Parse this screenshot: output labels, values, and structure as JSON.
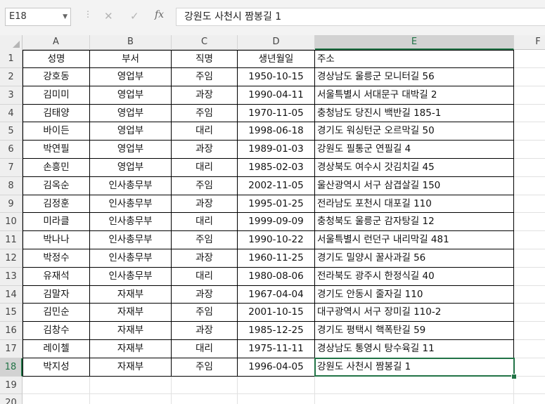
{
  "formula_bar": {
    "name_box": "E18",
    "cancel_icon": "✕",
    "enter_icon": "✓",
    "fx_label": "fx",
    "formula": "강원도 사천시 짬봉길 1"
  },
  "columns": [
    "A",
    "B",
    "C",
    "D",
    "E",
    "F"
  ],
  "active_column": "E",
  "active_row": 18,
  "row_numbers": [
    "1",
    "2",
    "3",
    "4",
    "5",
    "6",
    "7",
    "8",
    "9",
    "10",
    "11",
    "12",
    "13",
    "14",
    "15",
    "16",
    "17",
    "18",
    "19",
    "20"
  ],
  "table": {
    "headers": [
      "성명",
      "부서",
      "직명",
      "생년월일",
      "주소"
    ],
    "rows": [
      [
        "강호동",
        "영업부",
        "주임",
        "1950-10-15",
        "경상남도 울릉군 모니터길 56"
      ],
      [
        "김미미",
        "영업부",
        "과장",
        "1990-04-11",
        "서울특별시 서대문구 대박길 2"
      ],
      [
        "김태양",
        "영업부",
        "주임",
        "1970-11-05",
        "충청남도 당진시 백반길 185-1"
      ],
      [
        "바이든",
        "영업부",
        "대리",
        "1998-06-18",
        "경기도 워싱턴군 오르막길 50"
      ],
      [
        "박연필",
        "영업부",
        "과장",
        "1989-01-03",
        "강원도 필통군 연필길 4"
      ],
      [
        "손흥민",
        "영업부",
        "대리",
        "1985-02-03",
        "경상북도 여수시 갓김치길 45"
      ],
      [
        "김옥순",
        "인사총무부",
        "주임",
        "2002-11-05",
        "울산광역시 서구 삼겹살길 150"
      ],
      [
        "김정훈",
        "인사총무부",
        "과장",
        "1995-01-25",
        "전라남도 포천시 대포길 110"
      ],
      [
        "미라클",
        "인사총무부",
        "대리",
        "1999-09-09",
        "충청북도 울릉군 감자탕길 12"
      ],
      [
        "박나나",
        "인사총무부",
        "주임",
        "1990-10-22",
        "서울특별시 런던구 내리막길 481"
      ],
      [
        "박정수",
        "인사총무부",
        "과장",
        "1960-11-25",
        "경기도 밀양시 꿀사과길 56"
      ],
      [
        "유재석",
        "인사총무부",
        "대리",
        "1980-08-06",
        "전라북도 광주시 한정식길 40"
      ],
      [
        "김말자",
        "자재부",
        "과장",
        "1967-04-04",
        "경기도 안동시 줄자길 110"
      ],
      [
        "김민순",
        "자재부",
        "주임",
        "2001-10-15",
        "대구광역시 서구 장미길 110-2"
      ],
      [
        "김창수",
        "자재부",
        "과장",
        "1985-12-25",
        "경기도 평택시 핵폭탄길 59"
      ],
      [
        "레이첼",
        "자재부",
        "대리",
        "1975-11-11",
        "경상남도 통영시 탕수육길 11"
      ],
      [
        "박지성",
        "자재부",
        "주임",
        "1996-04-05",
        "강원도 사천시 짬봉길 1"
      ]
    ]
  },
  "colors": {
    "accent": "#217346",
    "header_bg": "#efefef"
  }
}
